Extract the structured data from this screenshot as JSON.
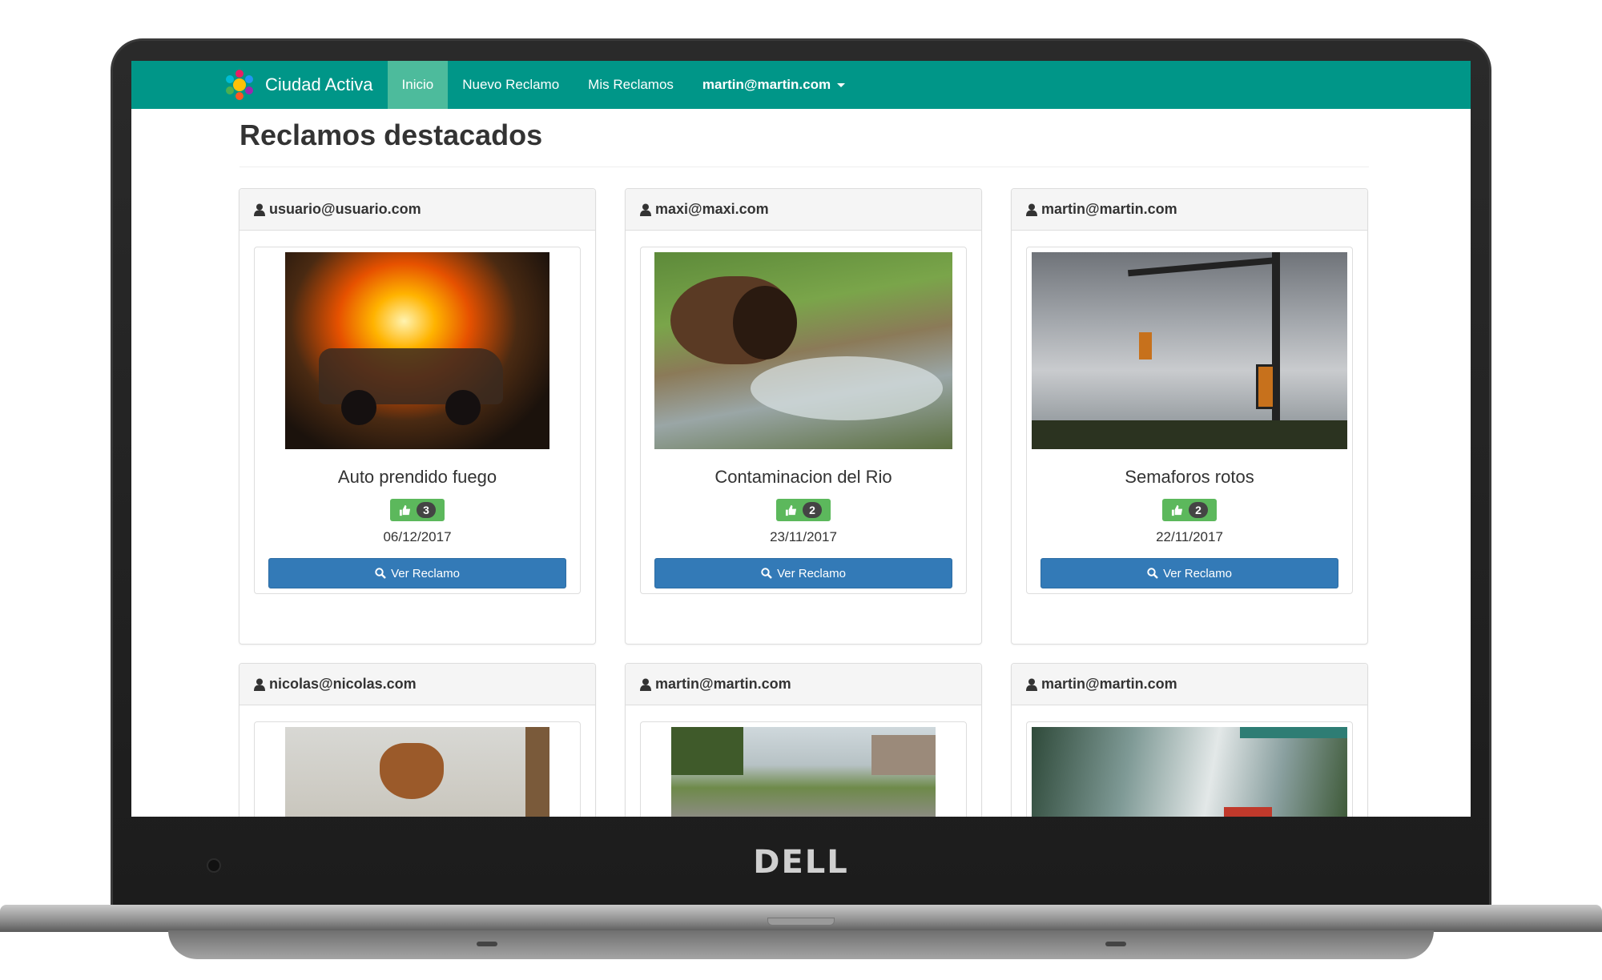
{
  "app": {
    "brand": "Ciudad Activa",
    "colors": {
      "navbar": "#009688",
      "active_tab": "#4dbb9c",
      "primary_button": "#337ab7",
      "like_badge": "#5cb85c"
    }
  },
  "navbar": {
    "items": [
      {
        "label": "Inicio",
        "active": true
      },
      {
        "label": "Nuevo Reclamo",
        "active": false
      },
      {
        "label": "Mis Reclamos",
        "active": false
      }
    ],
    "user": "martin@martin.com"
  },
  "page": {
    "title": "Reclamos destacados"
  },
  "claims": [
    {
      "user": "usuario@usuario.com",
      "title": "Auto prendido fuego",
      "likes": "3",
      "date": "06/12/2017",
      "button": "Ver Reclamo",
      "image": "burning-car-photo"
    },
    {
      "user": "maxi@maxi.com",
      "title": "Contaminacion del Rio",
      "likes": "2",
      "date": "23/11/2017",
      "button": "Ver Reclamo",
      "image": "polluted-river-pipe-photo"
    },
    {
      "user": "martin@martin.com",
      "title": "Semaforos rotos",
      "likes": "2",
      "date": "22/11/2017",
      "button": "Ver Reclamo",
      "image": "broken-traffic-light-photo"
    },
    {
      "user": "nicolas@nicolas.com",
      "image": "stray-dog-photo"
    },
    {
      "user": "martin@martin.com",
      "image": "damaged-street-photo"
    },
    {
      "user": "martin@martin.com",
      "image": "broken-bus-stop-photo"
    }
  ],
  "device": {
    "logo": "DELL"
  }
}
